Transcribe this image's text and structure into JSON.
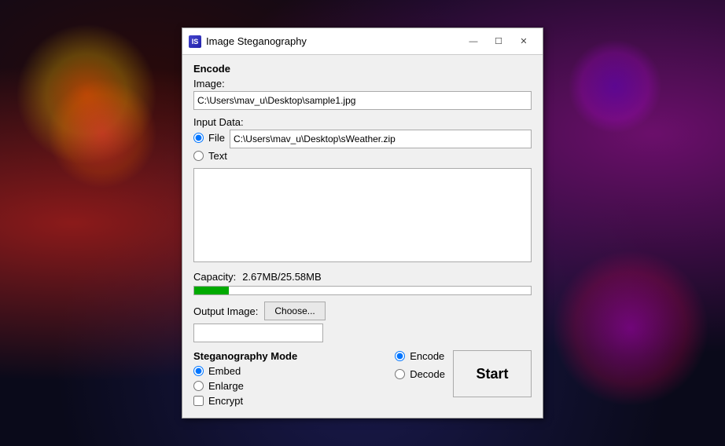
{
  "window": {
    "title": "Image Steganography",
    "icon_label": "IS"
  },
  "controls": {
    "minimize": "—",
    "maximize": "☐",
    "close": "✕"
  },
  "encode": {
    "section_label": "Encode",
    "image_label": "Image:",
    "image_path": "C:\\Users\\mav_u\\Desktop\\sample1.jpg"
  },
  "input_data": {
    "label": "Input Data:",
    "file_radio_label": "File",
    "file_path": "C:\\Users\\mav_u\\Desktop\\sWeather.zip",
    "text_radio_label": "Text"
  },
  "capacity": {
    "label": "Capacity:",
    "value": "2.67MB/25.58MB",
    "percent": 10.3
  },
  "output": {
    "label": "Output Image:",
    "choose_button": "Choose...",
    "path": ""
  },
  "steg_mode": {
    "label": "Steganography Mode",
    "embed_label": "Embed",
    "enlarge_label": "Enlarge",
    "encrypt_label": "Encrypt"
  },
  "encode_decode": {
    "encode_label": "Encode",
    "decode_label": "Decode"
  },
  "start": {
    "label": "Start"
  }
}
